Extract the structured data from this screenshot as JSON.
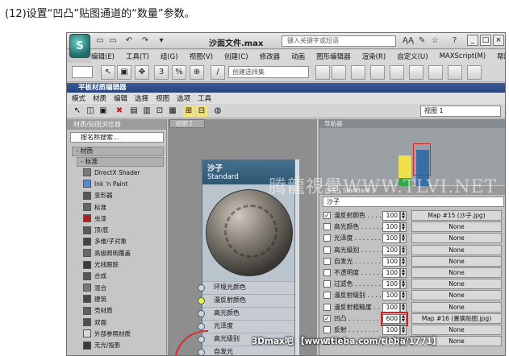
{
  "caption": "(12)设置“凹凸”贴图通道的“数量”参数。",
  "app": {
    "logo_glyph": "S",
    "doc_title": "沙面文件.max",
    "search_placeholder": "键入关键字或短语",
    "quick_access": [
      "▭",
      "▭",
      "↶",
      "↷",
      "▾"
    ],
    "right_icons": [
      "ĄĄ",
      "✎",
      "☆",
      "?"
    ],
    "window_buttons": [
      "_",
      "□",
      "×"
    ]
  },
  "menubar": [
    "编辑(E)",
    "工具(T)",
    "组(G)",
    "视图(V)",
    "创建(C)",
    "修改器",
    "动画",
    "图形编辑器",
    "渲染(R)",
    "自定义(U)",
    "MAXScript(M)",
    "帮助(H)"
  ],
  "toolbar": {
    "selection_filter": "创建选择集",
    "icons": [
      "↖",
      "▣",
      "✥",
      "3",
      "%",
      "⊕",
      "∕"
    ]
  },
  "sme": {
    "title": "平板材质编辑器",
    "menus": [
      "模式",
      "材质",
      "编辑",
      "选择",
      "视图",
      "选项",
      "工具"
    ],
    "tool_icons": [
      "↖",
      "◫",
      "▣",
      "✖",
      "▤",
      "▥",
      "⊡",
      "▦",
      "⊞",
      "⊟",
      "◍"
    ],
    "view_dropdown": "视图 1"
  },
  "browser": {
    "header": "材质/贴图浏览器",
    "search_placeholder": "按名称搜索...",
    "group_materials": "- 材质",
    "group_standard": "- 标准",
    "items": [
      {
        "label": "DirectX Shader",
        "color": "#7a7a7a"
      },
      {
        "label": "Ink 'n Paint",
        "color": "#4f8bd8"
      },
      {
        "label": "变形器",
        "color": "#555555"
      },
      {
        "label": "标准",
        "color": "#666666"
      },
      {
        "label": "虫漆",
        "color": "#b02020"
      },
      {
        "label": "顶/底",
        "color": "#5a5a5a"
      },
      {
        "label": "多维/子对象",
        "color": "#444444"
      },
      {
        "label": "高级照明覆盖",
        "color": "#6a6a6a"
      },
      {
        "label": "光线跟踪",
        "color": "#3c3c3c"
      },
      {
        "label": "合成",
        "color": "#555555"
      },
      {
        "label": "混合",
        "color": "#777777"
      },
      {
        "label": "建筑",
        "color": "#4a4a4a"
      },
      {
        "label": "壳材质",
        "color": "#606060"
      },
      {
        "label": "双面",
        "color": "#505050"
      },
      {
        "label": "外部参照材质",
        "color": "#d8d8d8"
      },
      {
        "label": "无光/投影",
        "color": "#3a3a3a"
      }
    ]
  },
  "view": {
    "tab": "视图 1",
    "node_title": "沙子",
    "node_type": "Standard",
    "slots": [
      "环境光颜色",
      "漫反射颜色",
      "高光颜色",
      "光泽度",
      "高光级别",
      "自发光"
    ],
    "active_slot_index": 1
  },
  "navigator": {
    "header": "导航器"
  },
  "params": {
    "header": "沙子 ( Standard )",
    "name": "沙子",
    "rows": [
      {
        "label": "漫反射颜色 . . . .",
        "checked": true,
        "amount": "100",
        "map": "Map #15 (沙子.jpg)"
      },
      {
        "label": "高光颜色 . . . . . .",
        "checked": false,
        "amount": "100",
        "map": "None"
      },
      {
        "label": "光泽度 . . . . . . .",
        "checked": false,
        "amount": "100",
        "map": "None"
      },
      {
        "label": "高光级别 . . . . . .",
        "checked": false,
        "amount": "100",
        "map": "None"
      },
      {
        "label": "自发光 . . . . . . .",
        "checked": false,
        "amount": "100",
        "map": "None"
      },
      {
        "label": "不透明度 . . . . . .",
        "checked": false,
        "amount": "100",
        "map": "None"
      },
      {
        "label": "过滤色 . . . . . . .",
        "checked": false,
        "amount": "100",
        "map": "None"
      },
      {
        "label": "漫反射级别 . . . .",
        "checked": false,
        "amount": "100",
        "map": "None"
      },
      {
        "label": "漫反射粗糙度 . . .",
        "checked": false,
        "amount": "100",
        "map": "None"
      },
      {
        "label": "凹凸 . . . . . . . .",
        "checked": true,
        "amount": "600",
        "map": "Map #16 (置换贴图.jpg)"
      },
      {
        "label": "反射 . . . . . . . .",
        "checked": false,
        "amount": "100",
        "map": "None"
      },
      {
        "label": "折射 . . . . . . . .",
        "checked": false,
        "amount": "100",
        "map": "None"
      }
    ]
  },
  "watermark": "腾龍視覺WWW.TLVI.NET",
  "bottom_watermark": "3Dmax吧 【www.tieba.com/tieba/1771】"
}
